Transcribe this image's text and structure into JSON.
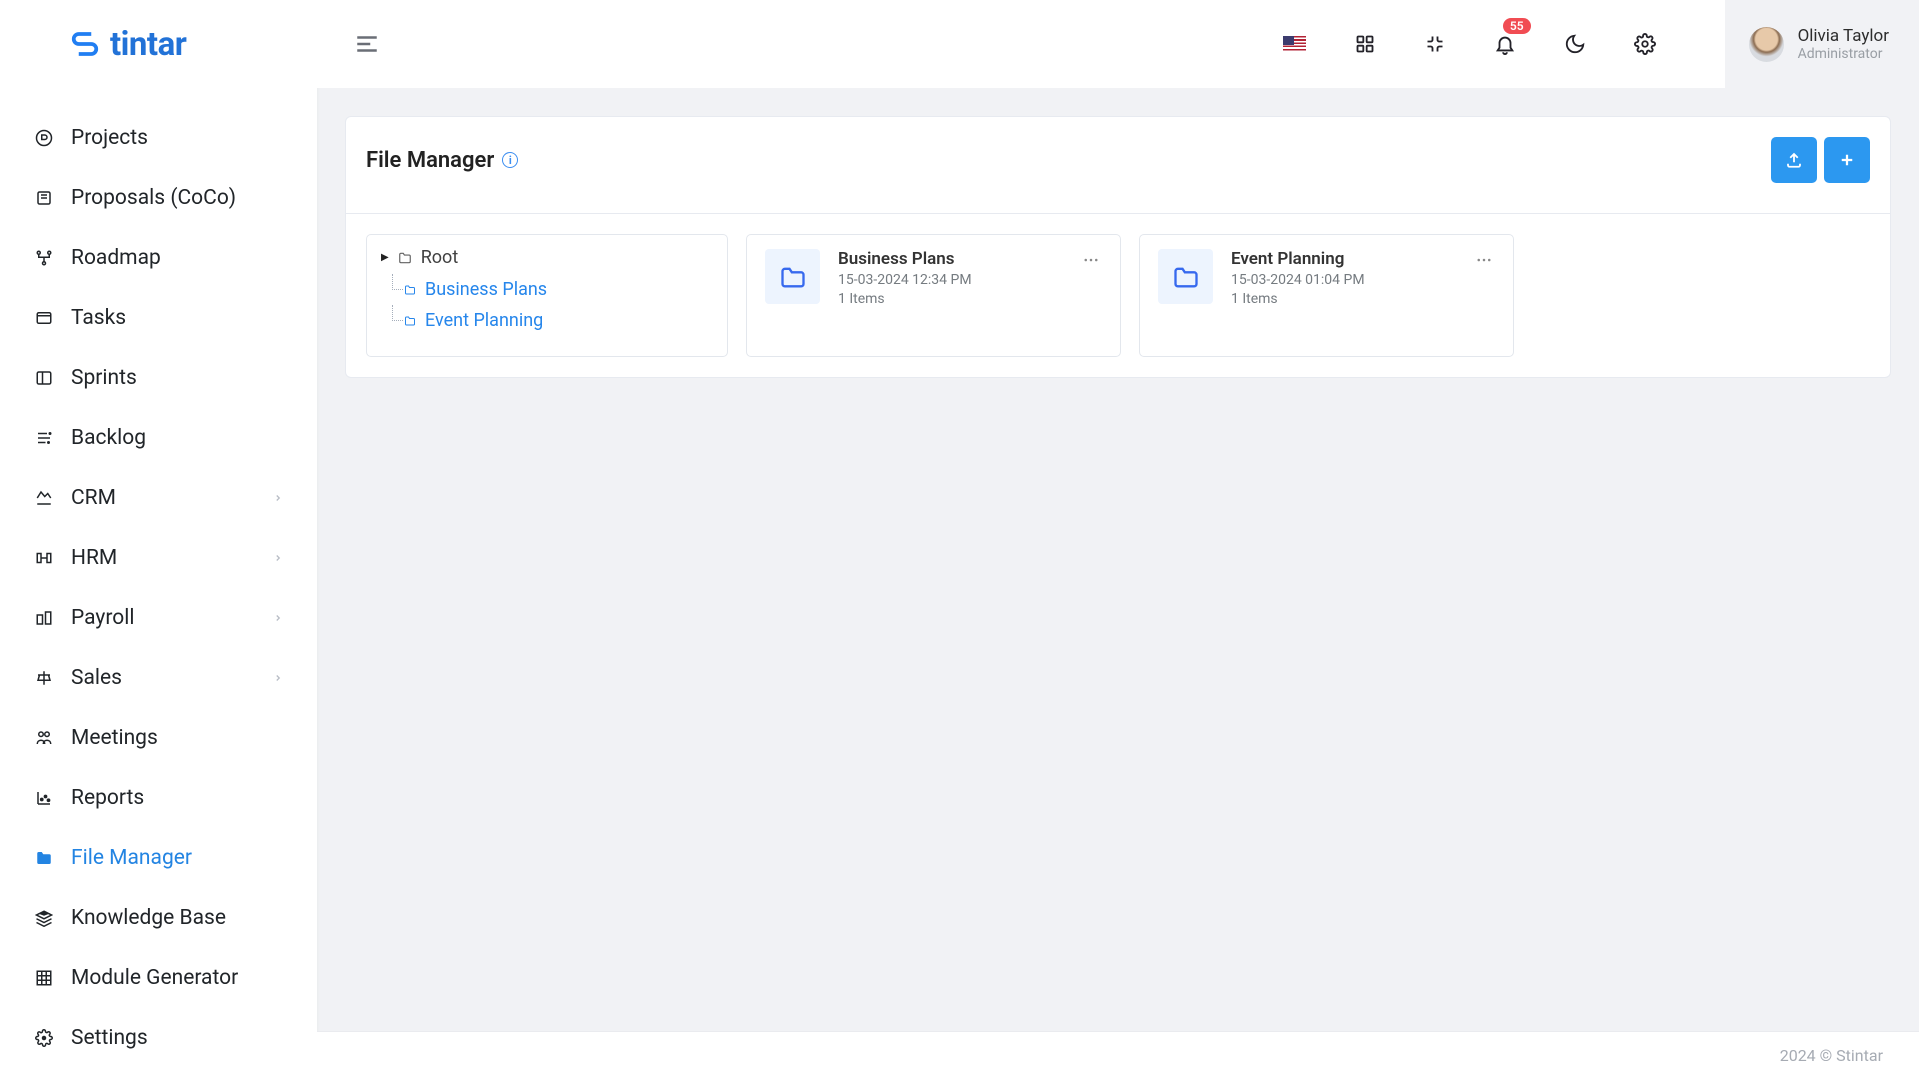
{
  "logo_text": "tintar",
  "sidebar": {
    "items": [
      {
        "label": "Projects"
      },
      {
        "label": "Proposals (CoCo)"
      },
      {
        "label": "Roadmap"
      },
      {
        "label": "Tasks"
      },
      {
        "label": "Sprints"
      },
      {
        "label": "Backlog"
      },
      {
        "label": "CRM",
        "chevron": true
      },
      {
        "label": "HRM",
        "chevron": true
      },
      {
        "label": "Payroll",
        "chevron": true
      },
      {
        "label": "Sales",
        "chevron": true
      },
      {
        "label": "Meetings"
      },
      {
        "label": "Reports"
      },
      {
        "label": "File Manager",
        "active": true
      },
      {
        "label": "Knowledge Base"
      },
      {
        "label": "Module Generator"
      },
      {
        "label": "Settings"
      }
    ]
  },
  "header": {
    "notifications": "55",
    "user": {
      "name": "Olivia Taylor",
      "role": "Administrator"
    }
  },
  "page": {
    "title": "File Manager"
  },
  "tree": {
    "root": "Root",
    "children": [
      {
        "label": "Business Plans"
      },
      {
        "label": "Event Planning"
      }
    ]
  },
  "folders": [
    {
      "name": "Business Plans",
      "date": "15-03-2024 12:34 PM",
      "items": "1 Items"
    },
    {
      "name": "Event Planning",
      "date": "15-03-2024 01:04 PM",
      "items": "1 Items"
    }
  ],
  "footer": "2024 © Stintar"
}
